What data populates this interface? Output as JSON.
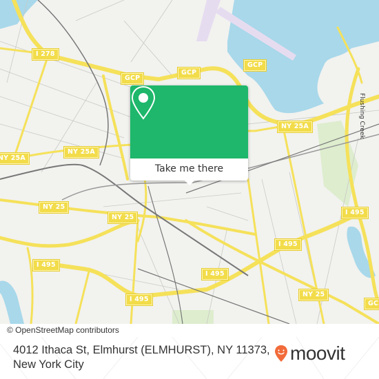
{
  "map": {
    "colors": {
      "water": "#a8d8ea",
      "land": "#f2f2ef",
      "highway": "#f5e15a",
      "park": "#d4ebc0",
      "airport": "#e6dcf0",
      "rail": "#777777"
    },
    "shields": [
      {
        "label": "I 278",
        "id": "i278"
      },
      {
        "label": "GCP",
        "id": "gcp-1"
      },
      {
        "label": "GCP",
        "id": "gcp-2"
      },
      {
        "label": "GCP",
        "id": "gcp-3"
      },
      {
        "label": "NY 25A",
        "id": "ny25a-1"
      },
      {
        "label": "NY 25A",
        "id": "ny25a-2"
      },
      {
        "label": "NY 25A",
        "id": "ny25a-3"
      },
      {
        "label": "NY 25",
        "id": "ny25-1"
      },
      {
        "label": "NY 25",
        "id": "ny25-2"
      },
      {
        "label": "NY 25",
        "id": "ny25-3"
      },
      {
        "label": "I 495",
        "id": "i495-1"
      },
      {
        "label": "I 495",
        "id": "i495-2"
      },
      {
        "label": "I 495",
        "id": "i495-3"
      },
      {
        "label": "I 495",
        "id": "i495-4"
      },
      {
        "label": "I 495",
        "id": "i495-5"
      },
      {
        "label": "GCP",
        "id": "gcp-4"
      }
    ],
    "water_label": "Flushing Creek"
  },
  "popup": {
    "icon": "map-pin-icon",
    "button_label": "Take me there",
    "accent": "#1eb76b"
  },
  "attribution": "© OpenStreetMap contributors",
  "footer": {
    "address_line1": "4012 Ithaca St, Elmhurst (ELMHURST), NY 11373,",
    "address_line2": "New York City",
    "logo_text": "moovit",
    "logo_color": "#f26b3a"
  }
}
